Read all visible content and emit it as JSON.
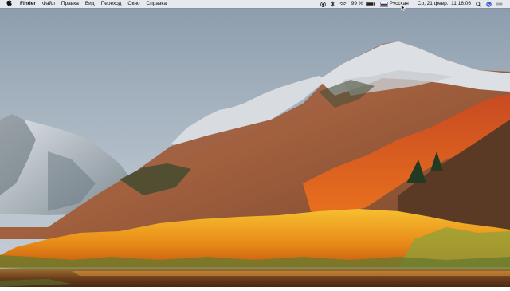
{
  "menubar": {
    "apple_icon": "apple-logo-icon",
    "app_name": "Finder",
    "menus": [
      "Файл",
      "Правка",
      "Вид",
      "Переход",
      "Окно",
      "Справка"
    ],
    "status": {
      "battery_percent": "99 %",
      "input_source": "Русская",
      "clock": "Ср, 21 февр.  11:16:06"
    },
    "icons": [
      "record-icon",
      "bluetooth-icon",
      "wifi-icon",
      "battery-icon",
      "russian-flag-icon",
      "search-icon",
      "siri-icon",
      "notification-center-icon"
    ]
  },
  "desktop": {
    "wallpaper": "macOS High Sierra mountain lake with autumn foliage"
  },
  "colors": {
    "menubar_bg": "#eceef1",
    "sky": "#9fb0bf",
    "foliage": "#f0a020",
    "lake": "#7a4a1a"
  }
}
